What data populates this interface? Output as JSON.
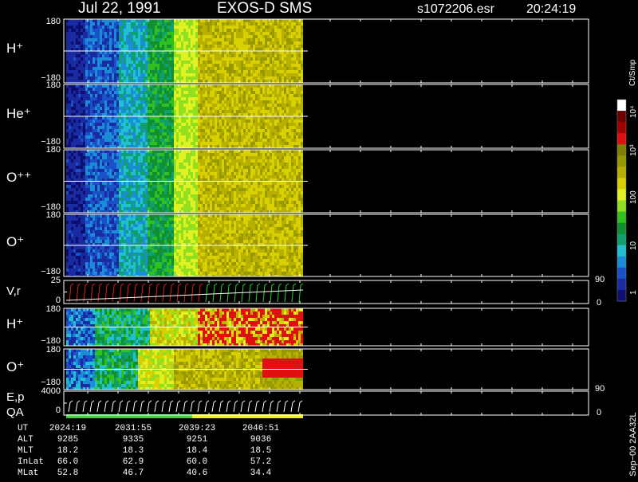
{
  "header": {
    "date": "Jul 22, 1991",
    "instrument": "EXOS-D SMS",
    "file": "s1072206.esr",
    "time": "20:24:19"
  },
  "colorbar": {
    "unit_label": "Ct/Smp",
    "ticks": [
      "10⁴",
      "10³",
      "100",
      "10",
      "1"
    ],
    "colors": [
      "#0d0f6e",
      "#1a2aa0",
      "#1a50c8",
      "#1a8cd8",
      "#20c0d0",
      "#10a070",
      "#109030",
      "#30c020",
      "#90e020",
      "#e0f020",
      "#d8d000",
      "#b8b000",
      "#989800",
      "#808000",
      "#e01010",
      "#a00000",
      "#700000",
      "#ffffff"
    ]
  },
  "panels": {
    "h_plus": {
      "label": "H⁺",
      "ymax": "180",
      "ymin": "−180"
    },
    "he_plus": {
      "label": "He⁺",
      "ymax": "180",
      "ymin": "−180"
    },
    "o_pp": {
      "label": "O⁺⁺",
      "ymax": "180",
      "ymin": "−180"
    },
    "o_plus": {
      "label": "O⁺",
      "ymax": "180",
      "ymin": "−180"
    },
    "vr": {
      "label": "V,r",
      "ymax": "25",
      "ymin": "0",
      "right_max": "90",
      "right_min": "0"
    },
    "h_plus2": {
      "label": "H⁺",
      "ymax": "180",
      "ymin": "−180"
    },
    "o_plus2": {
      "label": "O⁺",
      "ymax": "180",
      "ymin": "−180",
      "right": "90"
    },
    "ep": {
      "label": "E,p",
      "label2": "QA",
      "ymax": "4000",
      "ymin": "0",
      "right": "0"
    }
  },
  "side_note": "Sep−00  2AA32L",
  "footer": {
    "rows": [
      {
        "label": "UT",
        "values": [
          "2024:19",
          "2031:55",
          "2039:23",
          "2046:51"
        ]
      },
      {
        "label": "ALT",
        "values": [
          "9285",
          "9335",
          "9251",
          "9036"
        ]
      },
      {
        "label": "MLT",
        "values": [
          "18.2",
          "18.3",
          "18.4",
          "18.5"
        ]
      },
      {
        "label": "InLat",
        "values": [
          "66.0",
          "62.9",
          "60.0",
          "57.2"
        ]
      },
      {
        "label": "MLat",
        "values": [
          "52.8",
          "46.7",
          "40.6",
          "34.4"
        ]
      }
    ]
  },
  "chart_data": {
    "type": "heatmap",
    "x": [
      "2024:19",
      "2031:55",
      "2039:23",
      "2046:51"
    ],
    "color_scale": "log",
    "color_range": [
      1,
      10000
    ],
    "colorbar_label": "Ct/Smp",
    "pitch_angle_range": [
      -180,
      180
    ],
    "panels": [
      "H+",
      "He+",
      "O++",
      "O+",
      "V,r",
      "H+",
      "O+",
      "E,p"
    ]
  }
}
